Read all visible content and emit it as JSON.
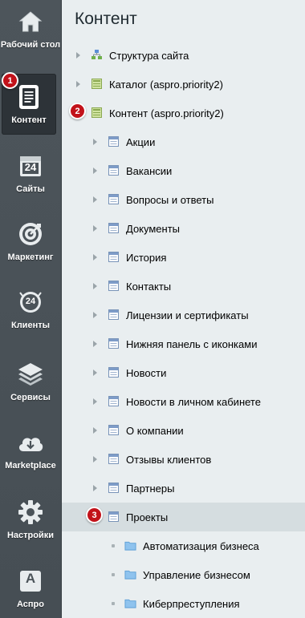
{
  "sidebar": {
    "items": [
      {
        "label": "Рабочий стол",
        "icon": "home-icon"
      },
      {
        "label": "Контент",
        "icon": "document-icon",
        "active": true
      },
      {
        "label": "Сайты",
        "icon": "calendar-24-icon"
      },
      {
        "label": "Маркетинг",
        "icon": "target-icon"
      },
      {
        "label": "Клиенты",
        "icon": "clients-24-icon"
      },
      {
        "label": "Сервисы",
        "icon": "layers-icon"
      },
      {
        "label": "Marketplace",
        "icon": "cloud-download-icon"
      },
      {
        "label": "Настройки",
        "icon": "gear-icon"
      },
      {
        "label": "Аспро",
        "icon": "aspro-a-icon"
      }
    ],
    "calendar_day": "24",
    "clients_day": "24",
    "aspro_letter": "A"
  },
  "panel": {
    "title": "Контент",
    "tree": [
      {
        "label": "Структура сайта",
        "type": "structure",
        "level": 0
      },
      {
        "label": "Каталог (aspro.priority2)",
        "type": "infoblock-type",
        "level": 0
      },
      {
        "label": "Контент (aspro.priority2)",
        "type": "infoblock-type",
        "level": 0
      },
      {
        "label": "Акции",
        "type": "infoblock",
        "level": 1
      },
      {
        "label": "Вакансии",
        "type": "infoblock",
        "level": 1
      },
      {
        "label": "Вопросы и ответы",
        "type": "infoblock",
        "level": 1
      },
      {
        "label": "Документы",
        "type": "infoblock",
        "level": 1
      },
      {
        "label": "История",
        "type": "infoblock",
        "level": 1
      },
      {
        "label": "Контакты",
        "type": "infoblock",
        "level": 1
      },
      {
        "label": "Лицензии и сертификаты",
        "type": "infoblock",
        "level": 1
      },
      {
        "label": "Нижняя панель с иконками",
        "type": "infoblock",
        "level": 1
      },
      {
        "label": "Новости",
        "type": "infoblock",
        "level": 1
      },
      {
        "label": "Новости в личном кабинете",
        "type": "infoblock",
        "level": 1
      },
      {
        "label": "О компании",
        "type": "infoblock",
        "level": 1
      },
      {
        "label": "Отзывы клиентов",
        "type": "infoblock",
        "level": 1
      },
      {
        "label": "Партнеры",
        "type": "infoblock",
        "level": 1
      },
      {
        "label": "Проекты",
        "type": "infoblock",
        "level": 1,
        "selected": true
      },
      {
        "label": "Автоматизация бизнеса",
        "type": "folder",
        "level": 2
      },
      {
        "label": "Управление бизнесом",
        "type": "folder",
        "level": 2
      },
      {
        "label": "Киберпреступления",
        "type": "folder",
        "level": 2
      }
    ]
  },
  "badges": {
    "one": "1",
    "two": "2",
    "three": "3"
  },
  "colors": {
    "sidebar_bg": "#4b5359",
    "panel_bg": "#e9eef0",
    "badge_red": "#c2121a",
    "selected_row": "#d5dde0",
    "folder_blue": "#8fc3ee"
  }
}
